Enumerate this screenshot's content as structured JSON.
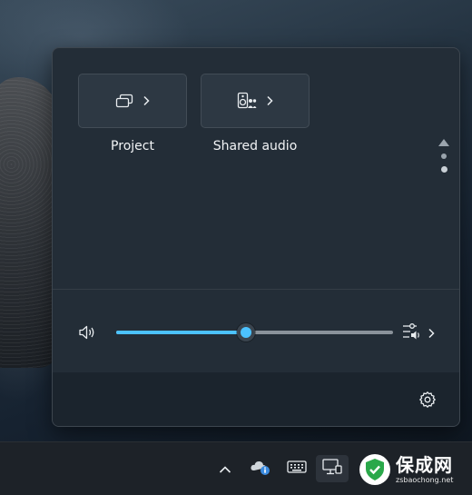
{
  "quick_settings": {
    "tiles": [
      {
        "label": "Project",
        "icon": "project-icon"
      },
      {
        "label": "Shared audio",
        "icon": "shared-audio-icon"
      }
    ],
    "pager": {
      "pages": 2,
      "current": 2
    },
    "volume": {
      "level": 0.47,
      "accent": "#4cc2ff",
      "icon": "speaker-icon",
      "mixer_icon": "audio-mixer-icon"
    },
    "footer": {
      "settings_icon": "gear-icon"
    }
  },
  "taskbar": {
    "icons": [
      "chevron-up-icon",
      "onedrive-icon",
      "keyboard-icon",
      "network-icon"
    ]
  },
  "watermark": {
    "title": "保成网",
    "subtitle": "zsbaochong.net"
  }
}
